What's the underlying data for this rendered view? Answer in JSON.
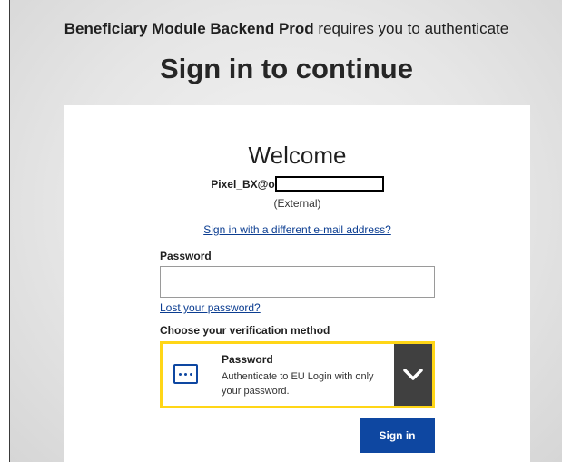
{
  "header": {
    "app_name": "Beneficiary Module Backend Prod",
    "app_suffix": " requires you to authenticate",
    "title": "Sign in to continue"
  },
  "card": {
    "welcome": "Welcome",
    "email_prefix": "Pixel_BX@o",
    "account_type": "(External)",
    "different_email_link": "Sign in with a different e-mail address?",
    "password_label": "Password",
    "password_value": "",
    "lost_password_link": "Lost your password?",
    "verification_label": "Choose your verification method",
    "method": {
      "icon": "password-dots-icon",
      "title": "Password",
      "description": "Authenticate to EU Login with only your password.",
      "toggle_icon": "chevron-down-icon"
    },
    "sign_in_button": "Sign in"
  },
  "colors": {
    "primary": "#0e47a1",
    "method_border": "#ffd617",
    "toggle_bg": "#404040",
    "link": "#0b3d91"
  }
}
